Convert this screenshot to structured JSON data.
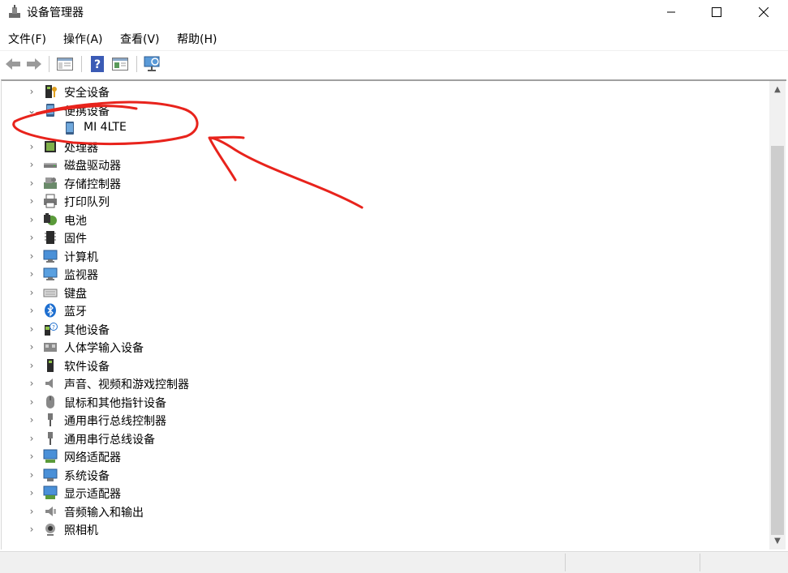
{
  "window": {
    "title": "设备管理器"
  },
  "menu": {
    "items": [
      "文件(F)",
      "操作(A)",
      "查看(V)",
      "帮助(H)"
    ]
  },
  "tree": {
    "nodes": [
      {
        "label": "安全设备",
        "icon": "security-device-icon",
        "state": "collapsed",
        "level": 1
      },
      {
        "label": "便携设备",
        "icon": "portable-device-icon",
        "state": "expanded",
        "level": 1
      },
      {
        "label": "MI 4LTE",
        "icon": "phone-icon",
        "state": "leaf",
        "level": 2
      },
      {
        "label": "处理器",
        "icon": "processor-icon",
        "state": "collapsed",
        "level": 1
      },
      {
        "label": "磁盘驱动器",
        "icon": "disk-drive-icon",
        "state": "collapsed",
        "level": 1
      },
      {
        "label": "存储控制器",
        "icon": "storage-controller-icon",
        "state": "collapsed",
        "level": 1
      },
      {
        "label": "打印队列",
        "icon": "printer-icon",
        "state": "collapsed",
        "level": 1
      },
      {
        "label": "电池",
        "icon": "battery-icon",
        "state": "collapsed",
        "level": 1
      },
      {
        "label": "固件",
        "icon": "firmware-icon",
        "state": "collapsed",
        "level": 1
      },
      {
        "label": "计算机",
        "icon": "computer-icon",
        "state": "collapsed",
        "level": 1
      },
      {
        "label": "监视器",
        "icon": "monitor-icon",
        "state": "collapsed",
        "level": 1
      },
      {
        "label": "键盘",
        "icon": "keyboard-icon",
        "state": "collapsed",
        "level": 1
      },
      {
        "label": "蓝牙",
        "icon": "bluetooth-icon",
        "state": "collapsed",
        "level": 1
      },
      {
        "label": "其他设备",
        "icon": "other-device-icon",
        "state": "collapsed",
        "level": 1
      },
      {
        "label": "人体学输入设备",
        "icon": "hid-icon",
        "state": "collapsed",
        "level": 1
      },
      {
        "label": "软件设备",
        "icon": "software-device-icon",
        "state": "collapsed",
        "level": 1
      },
      {
        "label": "声音、视频和游戏控制器",
        "icon": "speaker-icon",
        "state": "collapsed",
        "level": 1
      },
      {
        "label": "鼠标和其他指针设备",
        "icon": "mouse-icon",
        "state": "collapsed",
        "level": 1
      },
      {
        "label": "通用串行总线控制器",
        "icon": "usb-icon",
        "state": "collapsed",
        "level": 1
      },
      {
        "label": "通用串行总线设备",
        "icon": "usb-icon",
        "state": "collapsed",
        "level": 1
      },
      {
        "label": "网络适配器",
        "icon": "network-adapter-icon",
        "state": "collapsed",
        "level": 1
      },
      {
        "label": "系统设备",
        "icon": "system-device-icon",
        "state": "collapsed",
        "level": 1
      },
      {
        "label": "显示适配器",
        "icon": "display-adapter-icon",
        "state": "collapsed",
        "level": 1
      },
      {
        "label": "音频输入和输出",
        "icon": "audio-io-icon",
        "state": "collapsed",
        "level": 1
      },
      {
        "label": "照相机",
        "icon": "camera-icon",
        "state": "collapsed",
        "level": 1
      }
    ]
  },
  "annotation": {
    "color": "#e8231c"
  }
}
